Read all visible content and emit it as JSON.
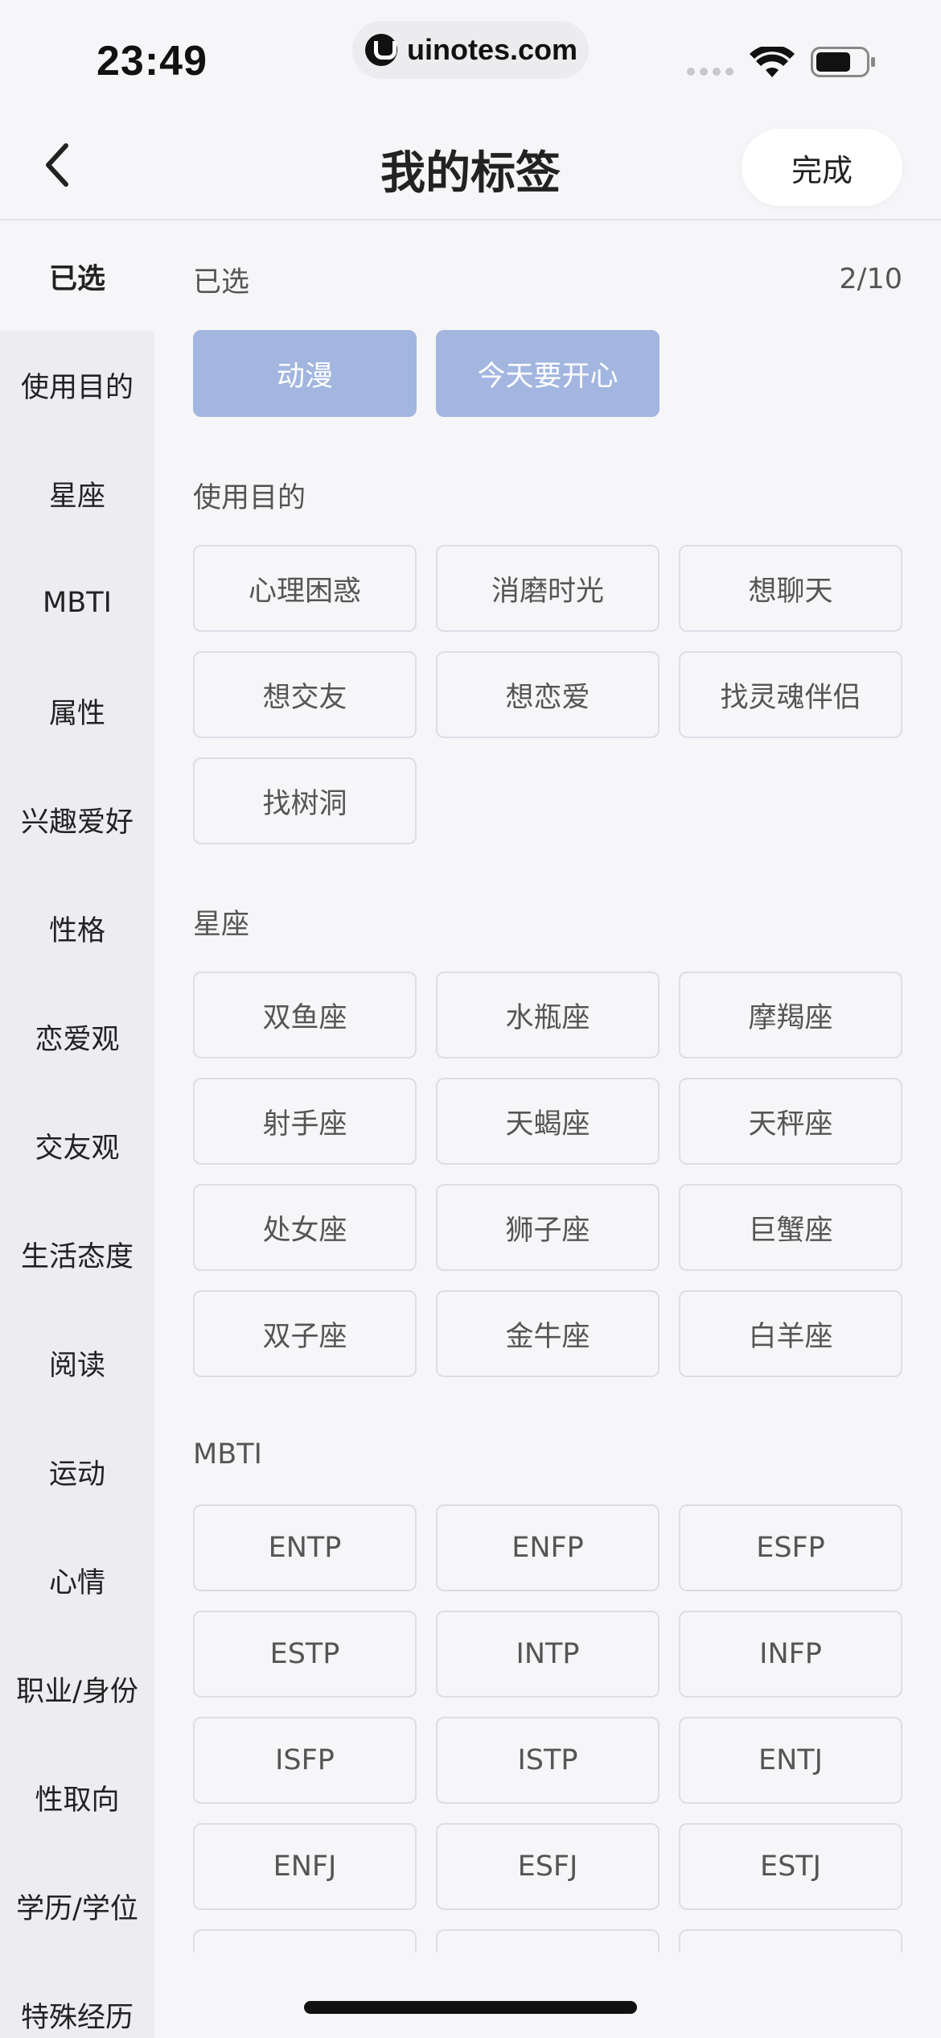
{
  "status": {
    "time": "23:49",
    "url": "uinotes.com"
  },
  "header": {
    "title": "我的标签",
    "done_label": "完成"
  },
  "sidebar": {
    "items": [
      {
        "label": "已选",
        "active": true
      },
      {
        "label": "使用目的"
      },
      {
        "label": "星座"
      },
      {
        "label": "MBTI"
      },
      {
        "label": "属性"
      },
      {
        "label": "兴趣爱好"
      },
      {
        "label": "性格"
      },
      {
        "label": "恋爱观"
      },
      {
        "label": "交友观"
      },
      {
        "label": "生活态度"
      },
      {
        "label": "阅读"
      },
      {
        "label": "运动"
      },
      {
        "label": "心情"
      },
      {
        "label": "职业/身份"
      },
      {
        "label": "性取向"
      },
      {
        "label": "学历/学位"
      },
      {
        "label": "特殊经历"
      }
    ]
  },
  "selected": {
    "title": "已选",
    "count": "2/10",
    "tags": [
      "动漫",
      "今天要开心"
    ]
  },
  "sections": [
    {
      "title": "使用目的",
      "tags": [
        "心理困惑",
        "消磨时光",
        "想聊天",
        "想交友",
        "想恋爱",
        "找灵魂伴侣",
        "找树洞"
      ]
    },
    {
      "title": "星座",
      "tags": [
        "双鱼座",
        "水瓶座",
        "摩羯座",
        "射手座",
        "天蝎座",
        "天秤座",
        "处女座",
        "狮子座",
        "巨蟹座",
        "双子座",
        "金牛座",
        "白羊座"
      ]
    },
    {
      "title": "MBTI",
      "tags": [
        "ENTP",
        "ENFP",
        "ESFP",
        "ESTP",
        "INTP",
        "INFP",
        "ISFP",
        "ISTP",
        "ENTJ",
        "ENFJ",
        "ESFJ",
        "ESTJ"
      ]
    }
  ],
  "colors": {
    "selected_tag": "#a2b6e0",
    "background": "#f6f6f8",
    "sidebar": "#ececf1"
  }
}
